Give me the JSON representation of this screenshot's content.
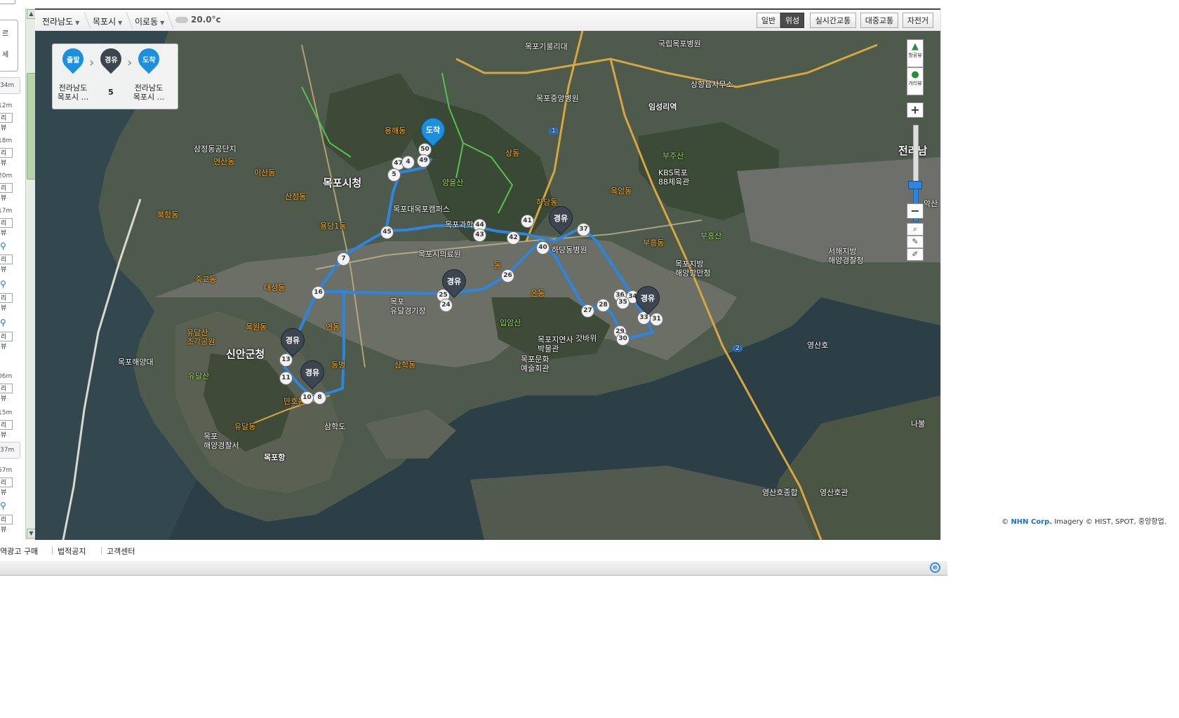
{
  "sidebar": {
    "panel_labels": [
      "르",
      "세"
    ],
    "distances": [
      "34m",
      "12m",
      "18m",
      "20m",
      "17m",
      "06m",
      "15m",
      "37m",
      "57m"
    ],
    "view_label": "리뷰"
  },
  "breadcrumb": {
    "items": [
      "전라남도",
      "목포시",
      "이로동"
    ],
    "weather": "20.0°c"
  },
  "map_types": {
    "items": [
      "일반",
      "위성",
      "실시간교통",
      "대중교통",
      "자전거"
    ],
    "active": "위성"
  },
  "route_summary": {
    "start_badge": "출발",
    "via_badge": "경유",
    "end_badge": "도착",
    "start_text": "전라남도\n목포시 ...",
    "via_count": "5",
    "end_text": "전라남도\n목포시 ..."
  },
  "controls": {
    "aerial_view": "항공뷰",
    "street_view": "거리뷰",
    "zoom_in": "+",
    "zoom_out": "−"
  },
  "pins": {
    "via_label": "경유",
    "end_label": "도착"
  },
  "waypoints": [
    "50",
    "49",
    "47",
    "4",
    "5",
    "45",
    "44",
    "43",
    "42",
    "41",
    "40",
    "37",
    "7",
    "16",
    "25",
    "24",
    "26",
    "27",
    "28",
    "36",
    "34",
    "35",
    "29",
    "30",
    "33",
    "31",
    "13",
    "11",
    "10",
    "8"
  ],
  "places": [
    {
      "name": "목포기룰리대",
      "style": ""
    },
    {
      "name": "국립목포병원",
      "style": ""
    },
    {
      "name": "상향읍사무소",
      "style": ""
    },
    {
      "name": "목포중앙병원",
      "style": ""
    },
    {
      "name": "임성리역",
      "style": "station"
    },
    {
      "name": "용해동",
      "style": "orange"
    },
    {
      "name": "상동",
      "style": "orange"
    },
    {
      "name": "부주산",
      "style": "green"
    },
    {
      "name": "KBS목포\n88체육관",
      "style": ""
    },
    {
      "name": "삼정동공단지",
      "style": ""
    },
    {
      "name": "연산동",
      "style": "orange"
    },
    {
      "name": "이산동",
      "style": "orange"
    },
    {
      "name": "목포시청",
      "style": "big"
    },
    {
      "name": "양을산",
      "style": "green"
    },
    {
      "name": "산정동",
      "style": "orange"
    },
    {
      "name": "목포대목포캠퍼스",
      "style": ""
    },
    {
      "name": "옥암동",
      "style": "orange"
    },
    {
      "name": "하당동",
      "style": "orange"
    },
    {
      "name": "부흥동",
      "style": "orange"
    },
    {
      "name": "부흥산",
      "style": "green"
    },
    {
      "name": "서해지방\n해양경찰청",
      "style": ""
    },
    {
      "name": "북항동",
      "style": "orange"
    },
    {
      "name": "용당1동",
      "style": "orange"
    },
    {
      "name": "목포시의료원",
      "style": ""
    },
    {
      "name": "목포지방\n해양항만청",
      "style": ""
    },
    {
      "name": "죽교동",
      "style": "orange"
    },
    {
      "name": "대성동",
      "style": "orange"
    },
    {
      "name": "목포\n유달경기장",
      "style": ""
    },
    {
      "name": "연동",
      "style": "orange"
    },
    {
      "name": "입암산",
      "style": "green"
    },
    {
      "name": "유달산\n조각공원",
      "style": "orange"
    },
    {
      "name": "목원동",
      "style": "orange"
    },
    {
      "name": "신안군청",
      "style": "big"
    },
    {
      "name": "목포지연사\n박물관",
      "style": ""
    },
    {
      "name": "갓바위",
      "style": ""
    },
    {
      "name": "목포문화\n예술회관",
      "style": ""
    },
    {
      "name": "영산호",
      "style": ""
    },
    {
      "name": "목포해양대",
      "style": ""
    },
    {
      "name": "유달산",
      "style": "green"
    },
    {
      "name": "삼학동",
      "style": "orange"
    },
    {
      "name": "만호동",
      "style": "orange"
    },
    {
      "name": "유달동",
      "style": "orange"
    },
    {
      "name": "삼학도",
      "style": ""
    },
    {
      "name": "목포\n해양경찰서",
      "style": ""
    },
    {
      "name": "목포항",
      "style": "station"
    },
    {
      "name": "나불",
      "style": ""
    },
    {
      "name": "영산호종합",
      "style": ""
    },
    {
      "name": "영산호관",
      "style": ""
    },
    {
      "name": "전라남",
      "style": ""
    },
    {
      "name": "악산",
      "style": ""
    },
    {
      "name": "목포과학",
      "style": ""
    },
    {
      "name": "동",
      "style": "orange"
    },
    {
      "name": "하당동병원",
      "style": ""
    },
    {
      "name": "동명",
      "style": "orange"
    },
    {
      "name": "온동",
      "style": "orange"
    },
    {
      "name": "1",
      "style": "route"
    },
    {
      "name": "2",
      "style": "route"
    }
  ],
  "copyright": {
    "prefix": "©",
    "brand": "NHN Corp.",
    "rest": "Imagery © HIST, SPOT, 중앙항업."
  },
  "footer": {
    "links": [
      "역광고 구매",
      "법적공지",
      "고객센터"
    ]
  }
}
